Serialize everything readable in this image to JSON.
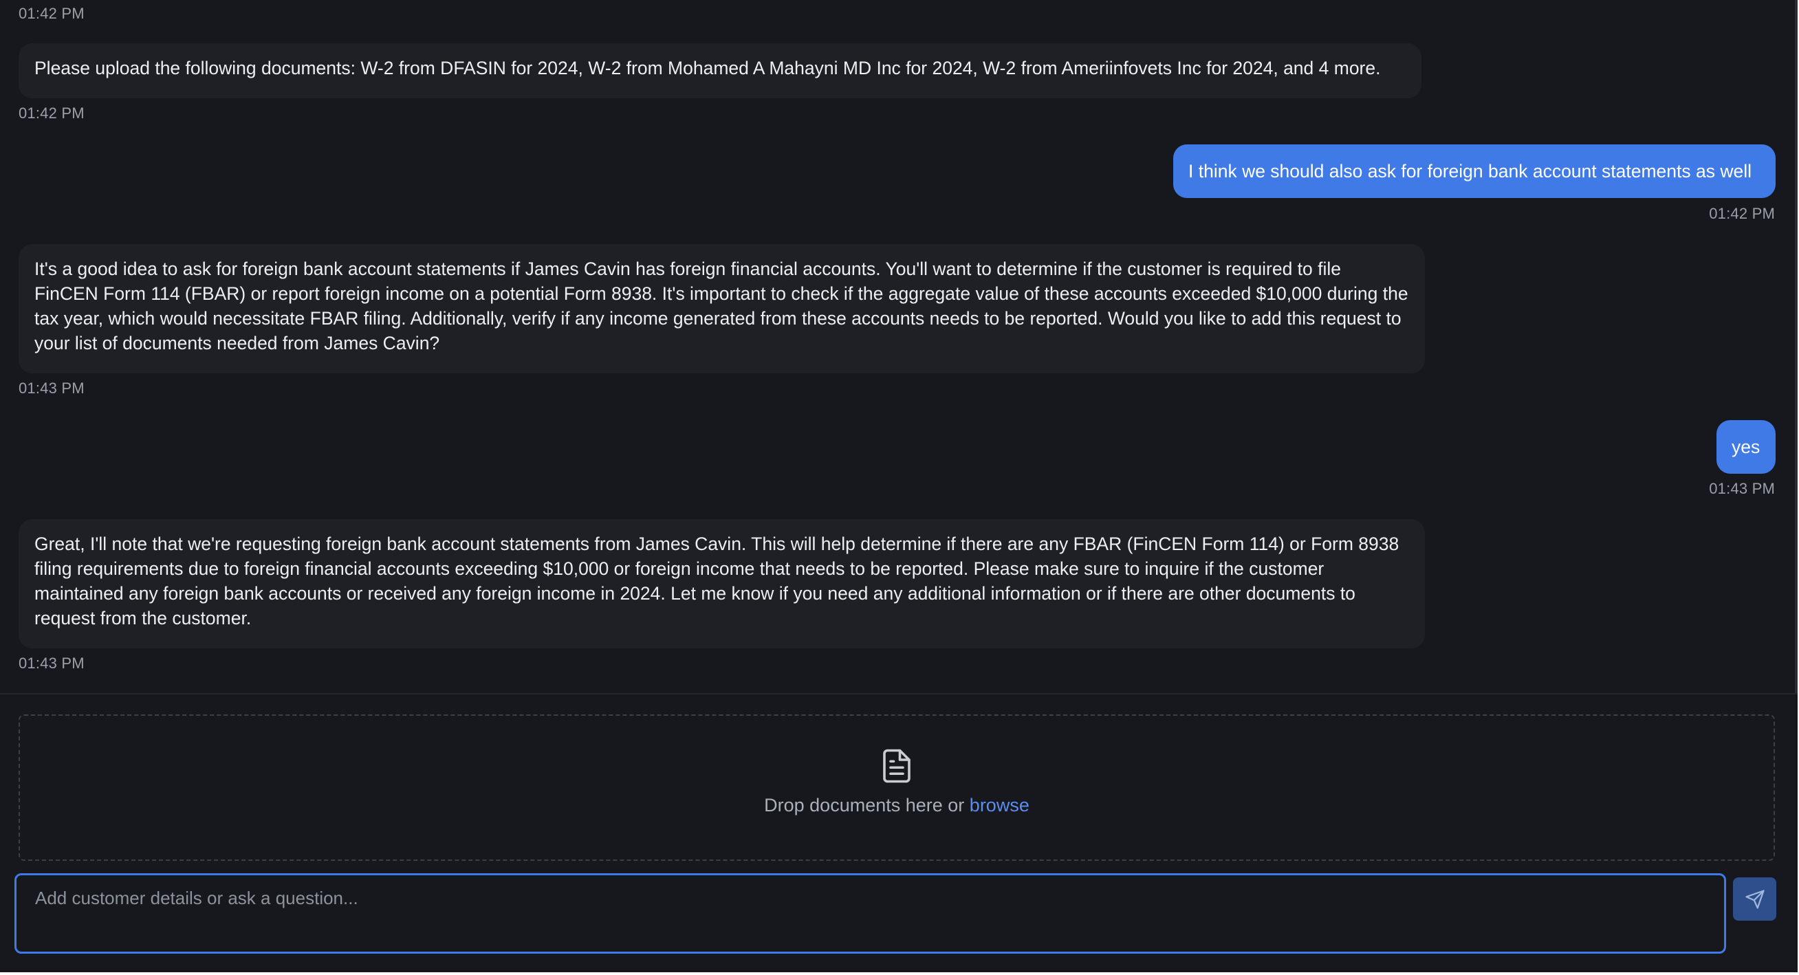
{
  "messages": [
    {
      "role": "assistant",
      "text": "Please upload the following documents: W-2 from DFASIN for 2024, W-2 from Mohamed A Mahayni MD Inc for 2024, W-2 from Ameriinfovets Inc for 2024, and 4 more.",
      "time": "01:42 PM"
    },
    {
      "role": "user",
      "text": "I think we should also ask for foreign bank account statements as well",
      "time": "01:42 PM"
    },
    {
      "role": "assistant",
      "text": "It's a good idea to ask for foreign bank account statements if James Cavin has foreign financial accounts. You'll want to determine if the customer is required to file FinCEN Form 114 (FBAR) or report foreign income on a potential Form 8938. It's important to check if the aggregate value of these accounts exceeded $10,000 during the tax year, which would necessitate FBAR filing. Additionally, verify if any income generated from these accounts needs to be reported. Would you like to add this request to your list of documents needed from James Cavin?",
      "time": "01:43 PM"
    },
    {
      "role": "user",
      "text": "yes",
      "time": "01:43 PM"
    },
    {
      "role": "assistant",
      "text": "Great, I'll note that we're requesting foreign bank account statements from James Cavin. This will help determine if there are any FBAR (FinCEN Form 114) or Form 8938 filing requirements due to foreign financial accounts exceeding $10,000 or foreign income that needs to be reported. Please make sure to inquire if the customer maintained any foreign bank accounts or received any foreign income in 2024. Let me know if you need any additional information or if there are other documents to request from the customer.",
      "time": "01:43 PM"
    }
  ],
  "top_time": "01:42 PM",
  "dropzone": {
    "text": "Drop documents here or ",
    "link": "browse",
    "icon": "document-icon"
  },
  "composer": {
    "placeholder": "Add customer details or ask a question...",
    "value": "",
    "send_icon": "send-icon"
  },
  "colors": {
    "background": "#16181d",
    "assistant_bubble": "#1e2026",
    "user_bubble": "#3f7ae6",
    "accent": "#3f7ae6",
    "link": "#5b8df0"
  }
}
